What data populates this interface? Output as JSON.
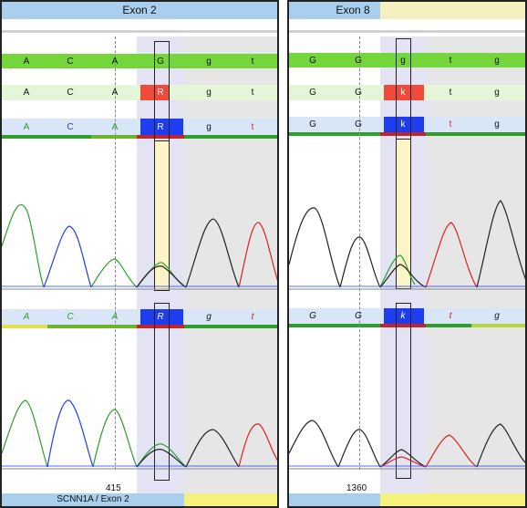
{
  "left": {
    "exon_label": "Exon 2",
    "ref_row": [
      "A",
      "C",
      "A",
      "G",
      "g",
      "t"
    ],
    "iupac_row": [
      "A",
      "C",
      "A",
      "R",
      "g",
      "t"
    ],
    "seq_row": [
      "A",
      "C",
      "A",
      "R",
      "g",
      "t"
    ],
    "lower_row": [
      "A",
      "C",
      "A",
      "R",
      "g",
      "t"
    ],
    "position": "415",
    "footer": "SCNN1A / Exon 2"
  },
  "right": {
    "exon_label": "Exon 8",
    "ref_row": [
      "G",
      "G",
      "g",
      "t",
      "g"
    ],
    "iupac_row": [
      "G",
      "G",
      "k",
      "t",
      "g"
    ],
    "seq_row": [
      "G",
      "G",
      "k",
      "t",
      "g"
    ],
    "lower_row": [
      "G",
      "G",
      "k",
      "t",
      "g"
    ],
    "position": "1360"
  },
  "colors": {
    "green_band": "#74d63a",
    "light_green_band": "#dff3d2",
    "blue_band": "#d6e4f7",
    "het_red": "#f04a3a",
    "het_blue": "#1e3cf0",
    "A": "#2ca02c",
    "C": "#1e3cf0",
    "G": "#111111",
    "T": "#e02020"
  }
}
